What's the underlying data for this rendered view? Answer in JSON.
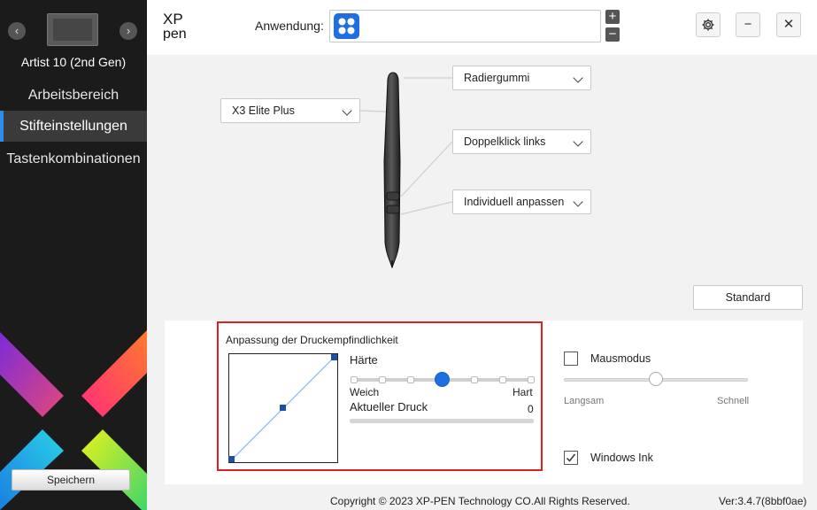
{
  "sidebar": {
    "device_name": "Artist 10 (2nd Gen)",
    "prev_glyph": "‹",
    "next_glyph": "›",
    "items": [
      {
        "label": "Arbeitsbereich",
        "active": false
      },
      {
        "label": "Stifteinstellungen",
        "active": true
      },
      {
        "label": "Tastenkombinationen",
        "active": false
      }
    ],
    "save_label": "Speichern"
  },
  "topbar": {
    "logo_line1": "XP",
    "logo_line2": "pen",
    "app_label": "Anwendung:",
    "add_glyph": "+",
    "remove_glyph": "−",
    "settings_icon": "gear-icon",
    "minimize_glyph": "−",
    "close_glyph": "✕"
  },
  "pen": {
    "model_dropdown": "X3 Elite Plus",
    "eraser_dropdown": "Radiergummi",
    "upper_button_dropdown": "Doppelklick links",
    "lower_button_dropdown": "Individuell anpassen",
    "standard_label": "Standard"
  },
  "pressure": {
    "title": "Anpassung der Druckempfindlichkeit",
    "hardness_label": "Härte",
    "soft_label": "Weich",
    "hard_label": "Hart",
    "hardness_level_fraction": 0.5,
    "current_pressure_label": "Aktueller Druck",
    "current_pressure_value": "0"
  },
  "mouse": {
    "mode_label": "Mausmodus",
    "mode_checked": false,
    "slow_label": "Langsam",
    "fast_label": "Schnell",
    "speed_fraction": 0.5
  },
  "windows_ink": {
    "label": "Windows Ink",
    "checked": true
  },
  "footer": {
    "copyright": "Copyright © 2023  XP-PEN Technology CO.All Rights Reserved.",
    "version": "Ver:3.4.7(8bbf0ae)"
  },
  "colors": {
    "accent": "#1f6fe0",
    "highlight_border": "#e02020",
    "sidebar_bg": "#1b1b1b"
  }
}
